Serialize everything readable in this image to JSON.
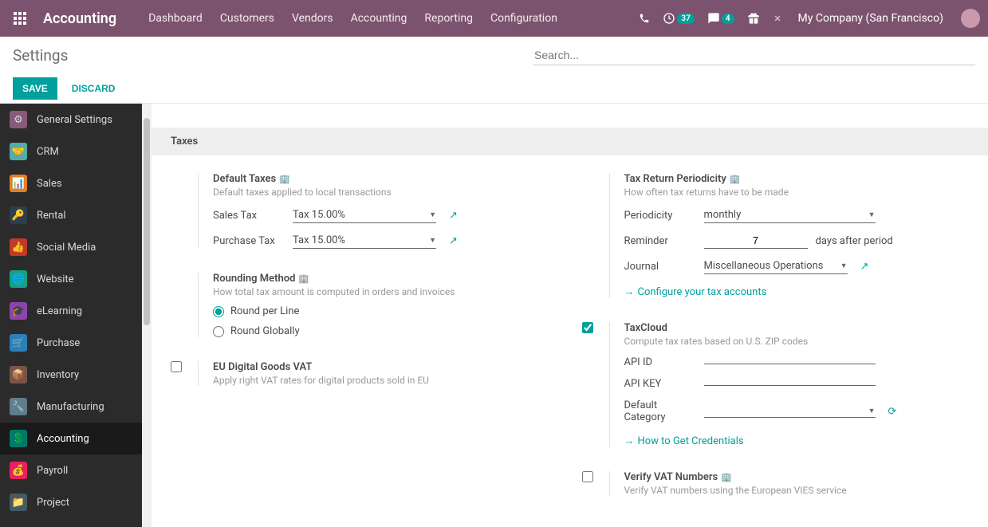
{
  "navbar": {
    "brand": "Accounting",
    "links": [
      "Dashboard",
      "Customers",
      "Vendors",
      "Accounting",
      "Reporting",
      "Configuration"
    ],
    "badge_activities": "37",
    "badge_messages": "4",
    "company": "My Company (San Francisco)"
  },
  "subheader": {
    "title": "Settings",
    "search_placeholder": "Search..."
  },
  "actions": {
    "save": "SAVE",
    "discard": "DISCARD"
  },
  "sidebar": {
    "items": [
      {
        "label": "General Settings"
      },
      {
        "label": "CRM"
      },
      {
        "label": "Sales"
      },
      {
        "label": "Rental"
      },
      {
        "label": "Social Media"
      },
      {
        "label": "Website"
      },
      {
        "label": "eLearning"
      },
      {
        "label": "Purchase"
      },
      {
        "label": "Inventory"
      },
      {
        "label": "Manufacturing"
      },
      {
        "label": "Accounting"
      },
      {
        "label": "Payroll"
      },
      {
        "label": "Project"
      }
    ]
  },
  "section": {
    "taxes": "Taxes"
  },
  "default_taxes": {
    "title": "Default Taxes",
    "desc": "Default taxes applied to local transactions",
    "sales_label": "Sales Tax",
    "sales_value": "Tax 15.00%",
    "purchase_label": "Purchase Tax",
    "purchase_value": "Tax 15.00%"
  },
  "periodicity": {
    "title": "Tax Return Periodicity",
    "desc": "How often tax returns have to be made",
    "period_label": "Periodicity",
    "period_value": "monthly",
    "reminder_label": "Reminder",
    "reminder_value": "7",
    "reminder_suffix": "days after period",
    "journal_label": "Journal",
    "journal_value": "Miscellaneous Operations",
    "config_link": "Configure your tax accounts"
  },
  "rounding": {
    "title": "Rounding Method",
    "desc": "How total tax amount is computed in orders and invoices",
    "opt1": "Round per Line",
    "opt2": "Round Globally"
  },
  "taxcloud": {
    "title": "TaxCloud",
    "desc": "Compute tax rates based on U.S. ZIP codes",
    "api_id_label": "API ID",
    "api_key_label": "API KEY",
    "cat_label": "Default Category",
    "creds_link": "How to Get Credentials"
  },
  "eu_vat": {
    "title": "EU Digital Goods VAT",
    "desc": "Apply right VAT rates for digital products sold in EU"
  },
  "vat_verify": {
    "title": "Verify VAT Numbers",
    "desc": "Verify VAT numbers using the European VIES service"
  }
}
